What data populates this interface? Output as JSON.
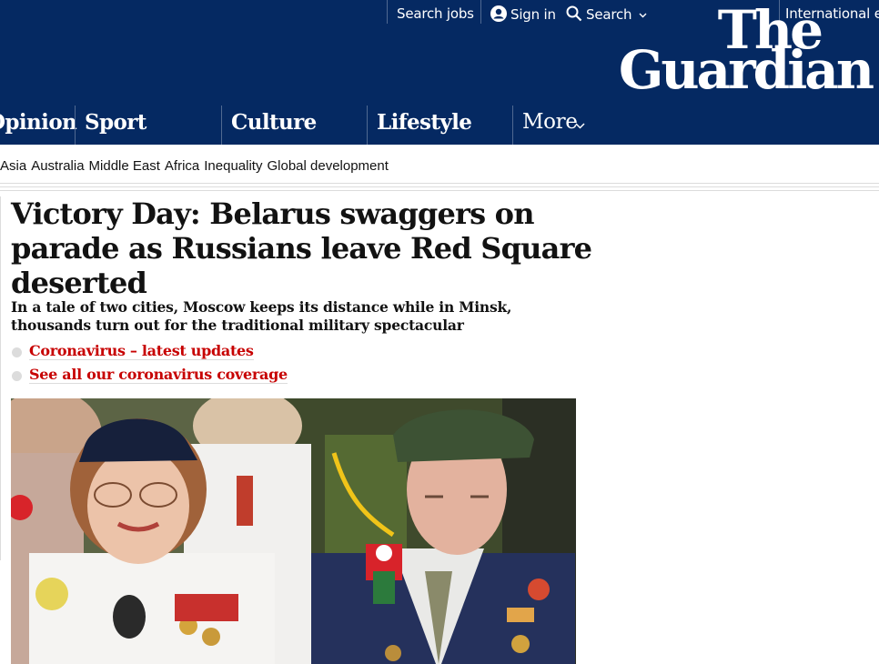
{
  "topbar": {
    "search_jobs": "Search jobs",
    "sign_in": "Sign in",
    "search": "Search",
    "edition": "International edition",
    "icons": {
      "sign_in": "user-circle-icon",
      "search": "magnifier-icon",
      "chevron": "chevron-down-icon"
    }
  },
  "logo": {
    "line1": "The",
    "line2": "Guardian"
  },
  "pillars": [
    {
      "label": "Opinion"
    },
    {
      "label": "Sport"
    },
    {
      "label": "Culture"
    },
    {
      "label": "Lifestyle"
    },
    {
      "label": "More"
    }
  ],
  "subnav": [
    "Asia",
    "Australia",
    "Middle East",
    "Africa",
    "Inequality",
    "Global development"
  ],
  "article": {
    "headline": "Victory Day: Belarus swaggers on parade as Russians leave Red Square deserted",
    "standfirst": "In a tale of two cities, Moscow keeps its distance while in Minsk, thousands turn out for the traditional military spectacular",
    "links": [
      {
        "label": "Coronavirus – latest updates"
      },
      {
        "label": "See all our coronavirus coverage"
      }
    ]
  },
  "colors": {
    "brand": "#052962",
    "link_red": "#c70000",
    "divider": "#dcdcdc",
    "text": "#121212"
  }
}
